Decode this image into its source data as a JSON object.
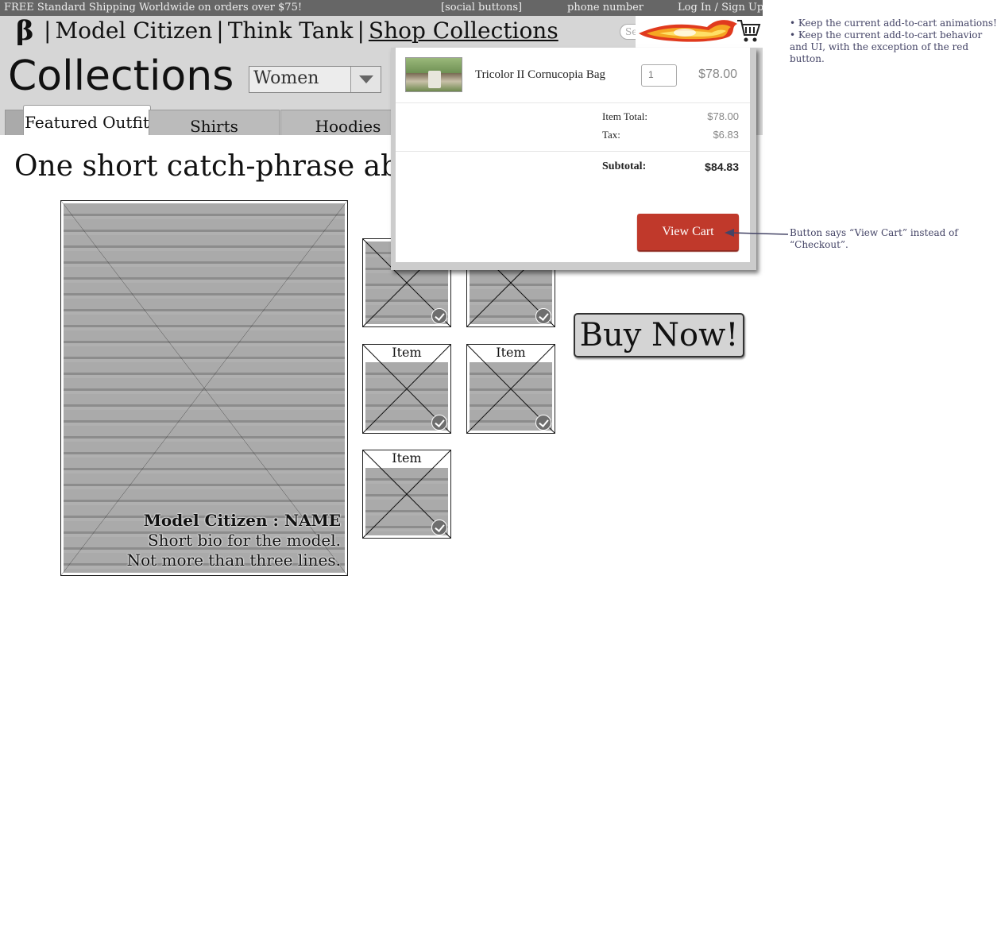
{
  "topbar": {
    "shipping": "FREE Standard Shipping Worldwide on orders over $75!",
    "social": "[social buttons]",
    "phone": "phone number",
    "login": "Log In / Sign Up"
  },
  "nav": {
    "logo": "β",
    "links": [
      "Model Citizen",
      "Think Tank",
      "Shop Collections"
    ],
    "separator": "|",
    "search_placeholder": "Se"
  },
  "collections": {
    "title": "Collections",
    "select_value": "Women",
    "tabs": [
      "Featured Outfit",
      "Shirts",
      "Hoodies"
    ],
    "catchphrase": "One short catch-phrase about"
  },
  "model": {
    "name": "Model Citizen : NAME",
    "bio_line1": "Short bio for the model.",
    "bio_line2": "Not more than three lines."
  },
  "items": {
    "label": "Item"
  },
  "buy_now": "Buy Now!",
  "cart": {
    "product_name": "Tricolor II Cornucopia Bag",
    "quantity": "1",
    "line_price": "$78.00",
    "item_total_label": "Item Total:",
    "item_total": "$78.00",
    "tax_label": "Tax:",
    "tax": "$6.83",
    "subtotal_label": "Subtotal:",
    "subtotal": "$84.83",
    "button": "View Cart"
  },
  "annotations": {
    "note1_line1": "• Keep the current add-to-cart animations!",
    "note1_line2": "• Keep the current add-to-cart behavior and UI, with the exception of the red button.",
    "note2": "Button says “View Cart” instead of “Checkout”."
  },
  "colors": {
    "topbar": "#666666",
    "navbar": "#d6d6d6",
    "view_cart_button": "#c0392b",
    "annotation_text": "#444466"
  }
}
